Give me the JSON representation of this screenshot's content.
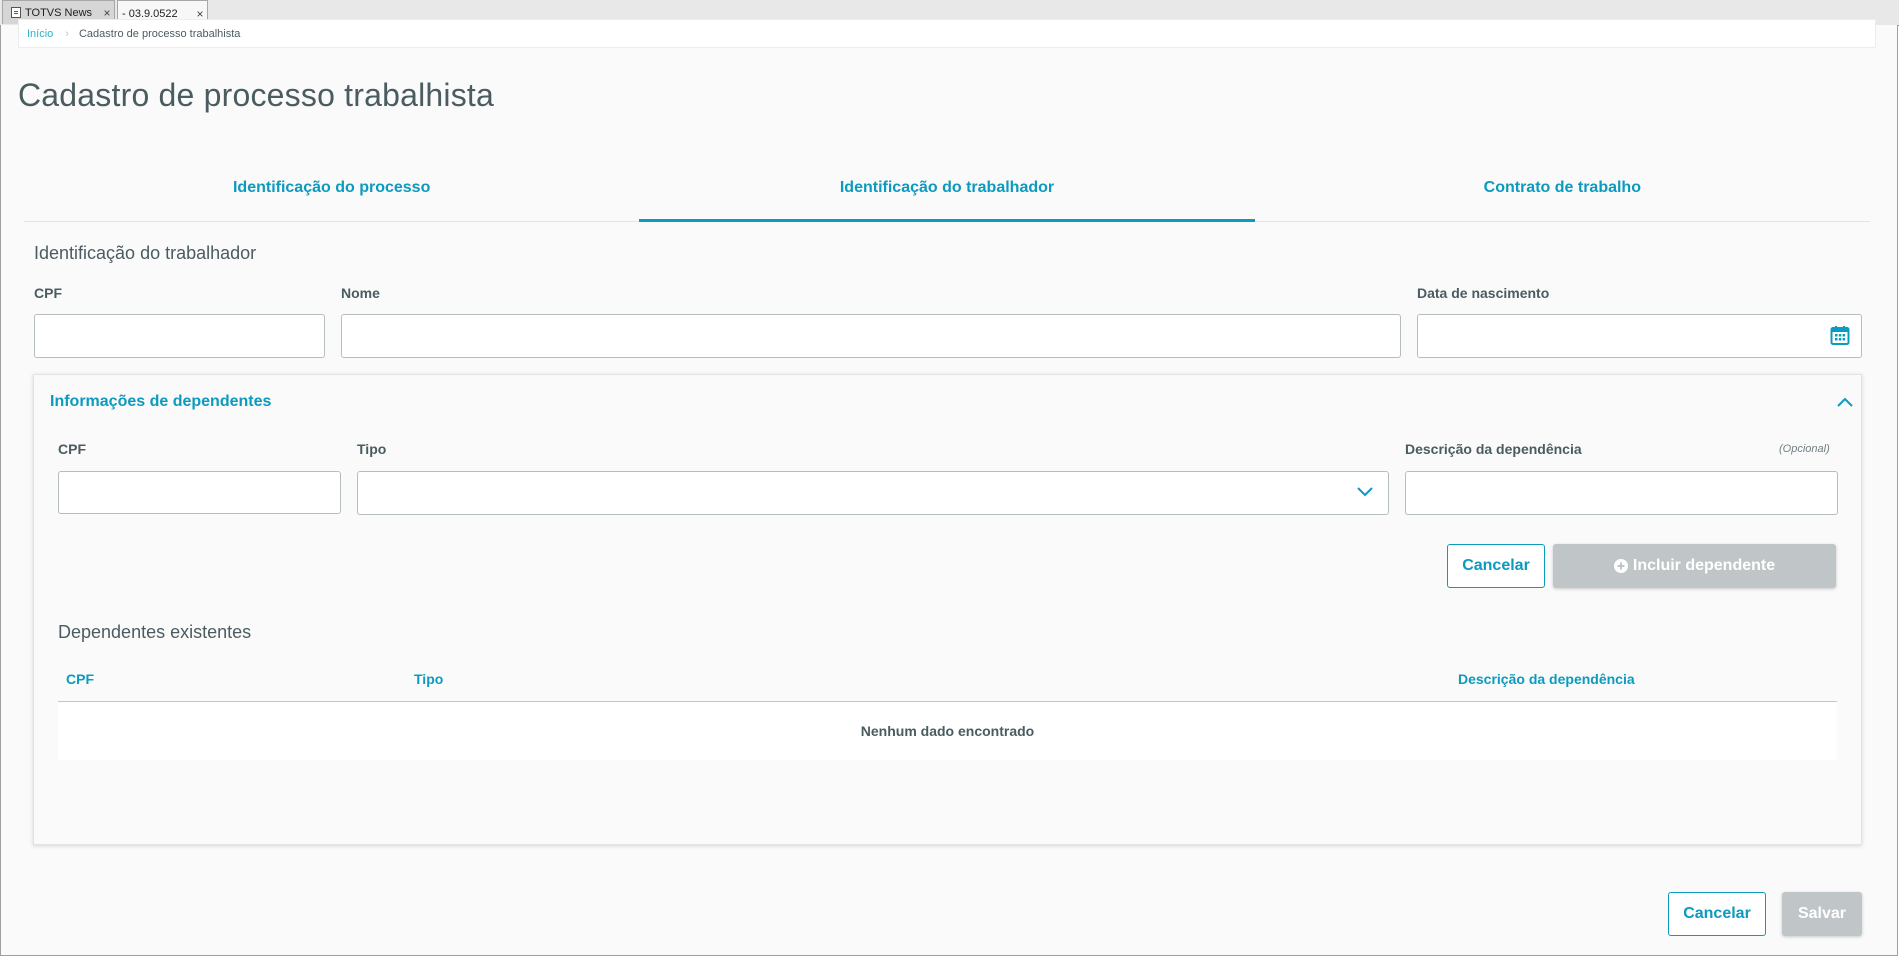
{
  "window_tabs": [
    {
      "label": "TOTVS News",
      "close": "×"
    },
    {
      "label": "- 03.9.0522",
      "close": "×"
    }
  ],
  "breadcrumb": {
    "home": "Início",
    "current": "Cadastro de processo trabalhista"
  },
  "page_title": "Cadastro de processo trabalhista",
  "tabs": [
    {
      "label": "Identificação do processo",
      "active": false
    },
    {
      "label": "Identificação do trabalhador",
      "active": true
    },
    {
      "label": "Contrato de trabalho",
      "active": false
    }
  ],
  "worker": {
    "section_title": "Identificação do trabalhador",
    "cpf": {
      "label": "CPF",
      "value": ""
    },
    "nome": {
      "label": "Nome",
      "value": ""
    },
    "data_nascimento": {
      "label": "Data de nascimento",
      "value": "",
      "icon": "calendar-icon"
    }
  },
  "dependents": {
    "title": "Informações de dependentes",
    "cpf": {
      "label": "CPF",
      "value": ""
    },
    "tipo": {
      "label": "Tipo",
      "value": ""
    },
    "descricao": {
      "label": "Descrição da dependência",
      "optional": "(Opcional)",
      "value": ""
    },
    "cancel_label": "Cancelar",
    "add_label": "Incluir dependente",
    "existing_title": "Dependentes existentes",
    "table": {
      "columns": [
        "CPF",
        "Tipo",
        "Descrição da dependência"
      ],
      "empty_text": "Nenhum dado encontrado"
    }
  },
  "footer": {
    "cancel_label": "Cancelar",
    "save_label": "Salvar"
  },
  "colors": {
    "accent": "#0c9abe",
    "disabled": "#c0c6c7",
    "text": "#4a5c60"
  }
}
